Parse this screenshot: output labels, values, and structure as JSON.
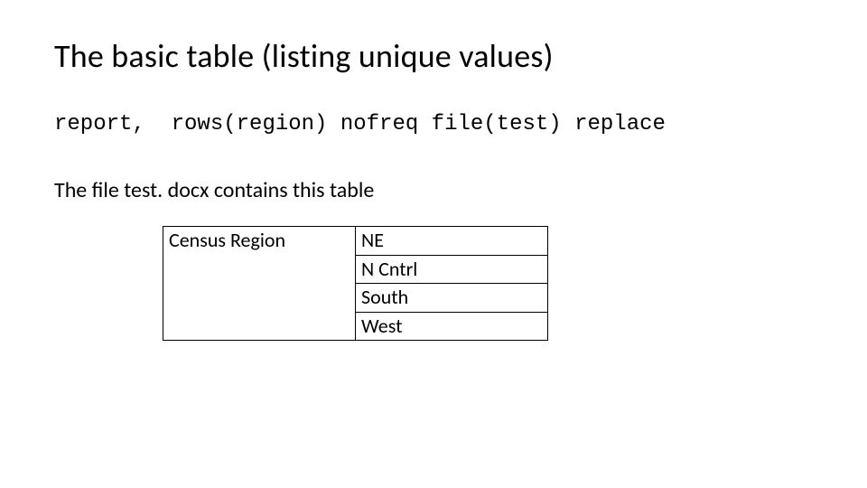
{
  "title": "The basic table (listing unique values)",
  "code_line": "report,  rows(region) nofreq file(test) replace",
  "body_text": "The file test. docx contains this table",
  "table": {
    "left_header": "Census Region",
    "values": [
      "NE",
      "N Cntrl",
      "South",
      "West"
    ]
  }
}
